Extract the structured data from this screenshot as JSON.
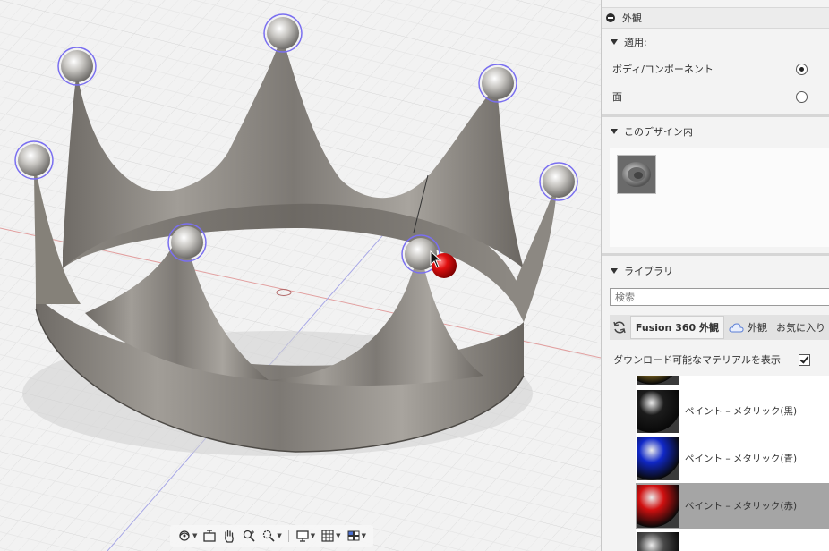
{
  "panel": {
    "title": "外観",
    "apply_section": {
      "label": "適用:",
      "options": [
        {
          "label": "ボディ/コンポーネント",
          "selected": true
        },
        {
          "label": "面",
          "selected": false
        }
      ]
    },
    "in_design_section": {
      "label": "このデザイン内",
      "thumb_icon": "ring-material-icon"
    },
    "library_section": {
      "label": "ライブラリ",
      "search_placeholder": "検索",
      "refresh_icon": "refresh-icon",
      "tabs": [
        {
          "label": "Fusion 360 外観",
          "active": true
        },
        {
          "label": "外観",
          "icon": "cloud-icon",
          "active": false
        },
        {
          "label": "お気に入り",
          "active": false
        }
      ],
      "show_downloadable": {
        "label": "ダウンロード可能なマテリアルを表示",
        "checked": true
      },
      "items": [
        {
          "label": "",
          "color": "#c8a030",
          "partial": true
        },
        {
          "label": "ペイント – メタリック(黒)",
          "color": "#1c1c1c"
        },
        {
          "label": "ペイント – メタリック(青)",
          "color": "#1028c8"
        },
        {
          "label": "ペイント – メタリック(赤)",
          "color": "#d01010",
          "selected": true
        },
        {
          "label": "",
          "color": "#4a4a4a",
          "partial": true
        }
      ]
    }
  },
  "viewport": {
    "background": "#f2f2f2",
    "crown_color": "#8f8b84",
    "pearl_color": "#d8d6d2",
    "selection_color": "#7a6ff0",
    "drag_ball_color": "#e01010",
    "toolbar": [
      {
        "icon": "orbit-icon",
        "caret": true
      },
      {
        "icon": "look-at-icon",
        "caret": false
      },
      {
        "icon": "pan-hand-icon",
        "caret": false
      },
      {
        "icon": "zoom-icon",
        "caret": false
      },
      {
        "icon": "zoom-window-icon",
        "caret": true
      },
      {
        "icon": "display-settings-icon",
        "caret": true
      },
      {
        "icon": "grid-icon",
        "caret": true
      },
      {
        "icon": "viewports-icon",
        "caret": true
      }
    ]
  }
}
